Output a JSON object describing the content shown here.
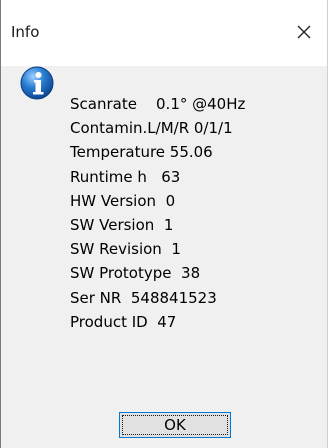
{
  "window": {
    "title": "Info",
    "close_icon": "close-icon"
  },
  "content": {
    "icon": "info-icon",
    "lines": [
      "Scanrate    0.1° @40Hz",
      "Contamin.L/M/R 0/1/1",
      "Temperature 55.06",
      "Runtime h   63",
      "HW Version  0",
      "SW Version  1",
      "SW Revision  1",
      "SW Prototype  38",
      "Ser NR  548841523",
      "Product ID  47"
    ]
  },
  "buttons": {
    "ok_label": "OK"
  },
  "colors": {
    "title_bg": "#ffffff",
    "body_bg": "#f0f0f0",
    "button_border": "#0078d7",
    "icon_blue": "#1565c0"
  }
}
